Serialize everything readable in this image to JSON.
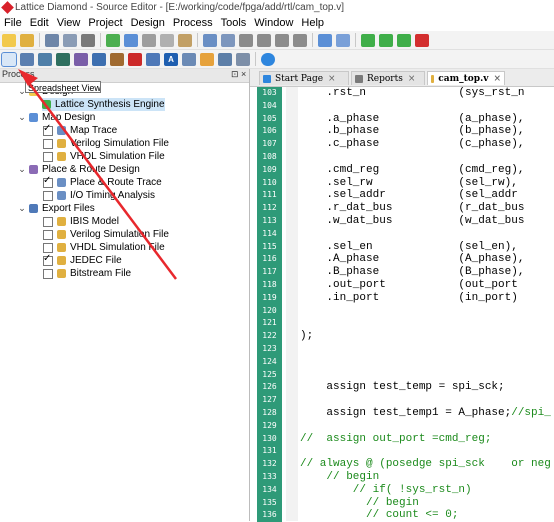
{
  "window": {
    "title": "Lattice Diamond - Source Editor - [E:/working/code/fpga/add/rtl/cam_top.v]"
  },
  "menu": [
    "File",
    "Edit",
    "View",
    "Project",
    "Design",
    "Process",
    "Tools",
    "Window",
    "Help"
  ],
  "tooltip": "Spreadsheet View",
  "process_pane": {
    "header": "Process",
    "controls": [
      "⊡",
      "×"
    ],
    "items": [
      {
        "label": "Design",
        "level": 0,
        "expanded": true
      },
      {
        "label": "Lattice Synthesis Engine",
        "level": 1,
        "selected": true
      },
      {
        "label": "Map Design",
        "level": 0,
        "expanded": true
      },
      {
        "label": "Map Trace",
        "level": 1,
        "checked": true
      },
      {
        "label": "Verilog Simulation File",
        "level": 1,
        "checked": false
      },
      {
        "label": "VHDL Simulation File",
        "level": 1,
        "checked": false
      },
      {
        "label": "Place & Route Design",
        "level": 0,
        "expanded": true
      },
      {
        "label": "Place & Route Trace",
        "level": 1,
        "checked": true
      },
      {
        "label": "I/O Timing Analysis",
        "level": 1,
        "checked": false
      },
      {
        "label": "Export Files",
        "level": 0,
        "expanded": true
      },
      {
        "label": "IBIS Model",
        "level": 1,
        "checked": false
      },
      {
        "label": "Verilog Simulation File",
        "level": 1,
        "checked": false
      },
      {
        "label": "VHDL Simulation File",
        "level": 1,
        "checked": false
      },
      {
        "label": "JEDEC File",
        "level": 1,
        "checked": true
      },
      {
        "label": "Bitstream File",
        "level": 1,
        "checked": false
      }
    ]
  },
  "tabs": [
    {
      "label": "Start Page",
      "active": false
    },
    {
      "label": "Reports",
      "active": false
    },
    {
      "label": "cam_top.v",
      "active": true
    }
  ],
  "editor": {
    "lines": [
      {
        "n": "103",
        "text": "    .rst_n              (sys_rst_n",
        "comment": false
      },
      {
        "n": "104",
        "text": "",
        "comment": false
      },
      {
        "n": "105",
        "text": "    .a_phase            (a_phase),",
        "comment": false
      },
      {
        "n": "106",
        "text": "    .b_phase            (b_phase),",
        "comment": false
      },
      {
        "n": "107",
        "text": "    .c_phase            (c_phase),",
        "comment": false
      },
      {
        "n": "108",
        "text": "",
        "comment": false
      },
      {
        "n": "109",
        "text": "    .cmd_reg            (cmd_reg),",
        "comment": false
      },
      {
        "n": "110",
        "text": "    .sel_rw             (sel_rw),",
        "comment": false
      },
      {
        "n": "111",
        "text": "    .sel_addr           (sel_addr",
        "comment": false
      },
      {
        "n": "112",
        "text": "    .r_dat_bus          (r_dat_bus",
        "comment": false
      },
      {
        "n": "113",
        "text": "    .w_dat_bus          (w_dat_bus",
        "comment": false
      },
      {
        "n": "114",
        "text": "",
        "comment": false
      },
      {
        "n": "115",
        "text": "    .sel_en             (sel_en),",
        "comment": false
      },
      {
        "n": "116",
        "text": "    .A_phase            (A_phase),",
        "comment": false
      },
      {
        "n": "117",
        "text": "    .B_phase            (B_phase),",
        "comment": false
      },
      {
        "n": "118",
        "text": "    .out_port           (out_port",
        "comment": false
      },
      {
        "n": "119",
        "text": "    .in_port            (in_port)",
        "comment": false
      },
      {
        "n": "120",
        "text": "",
        "comment": false
      },
      {
        "n": "121",
        "text": "",
        "comment": false
      },
      {
        "n": "122",
        "text": ");",
        "comment": false
      },
      {
        "n": "123",
        "text": "",
        "comment": false
      },
      {
        "n": "124",
        "text": "",
        "comment": false
      },
      {
        "n": "125",
        "text": "",
        "comment": false
      },
      {
        "n": "126",
        "text": "    assign test_temp = spi_sck;",
        "comment": false
      },
      {
        "n": "127",
        "text": "",
        "comment": false
      },
      {
        "n": "128",
        "text": "    assign test_temp1 = A_phase;",
        "comment": false,
        "trail": "//spi_"
      },
      {
        "n": "129",
        "text": "",
        "comment": false
      },
      {
        "n": "130",
        "text": "//  assign out_port =cmd_reg;",
        "comment": true
      },
      {
        "n": "131",
        "text": "",
        "comment": false
      },
      {
        "n": "132",
        "text": "// always @ (posedge spi_sck    or neg",
        "comment": true
      },
      {
        "n": "133",
        "text": "    // begin",
        "comment": true
      },
      {
        "n": "134",
        "text": "        // if( !sys_rst_n)",
        "comment": true
      },
      {
        "n": "135",
        "text": "          // begin",
        "comment": true
      },
      {
        "n": "136",
        "text": "          // count <= 0;",
        "comment": true
      }
    ]
  },
  "colors": {
    "line_number_bg": "#2e9a78",
    "comment": "#1b8a1b",
    "arrow": "#e8282d"
  }
}
